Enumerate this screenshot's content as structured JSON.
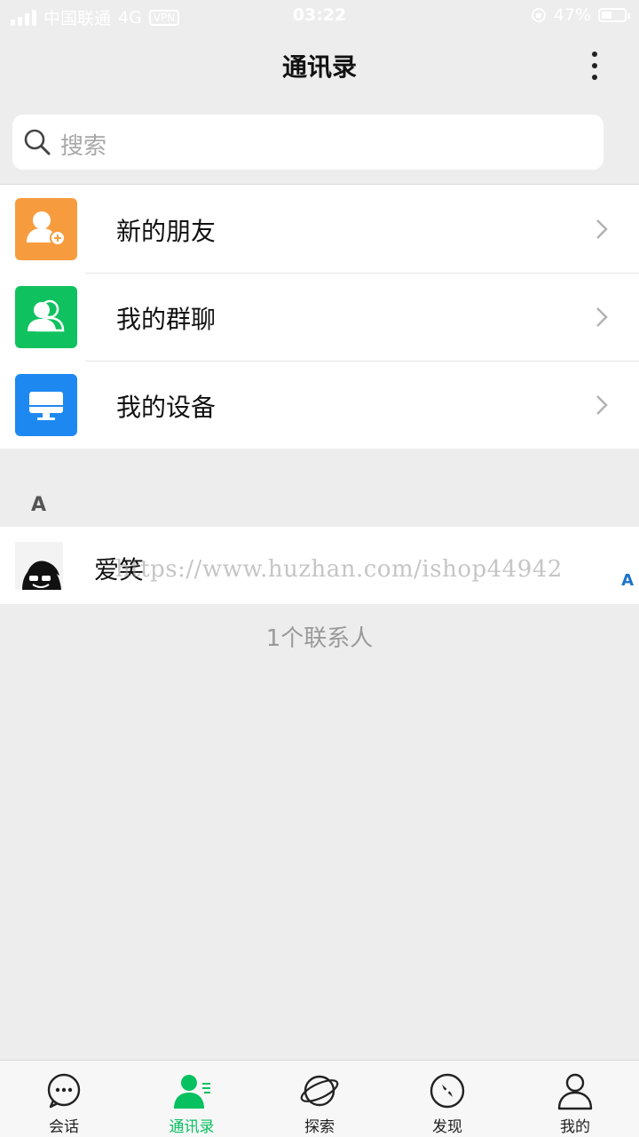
{
  "status_bar": {
    "carrier": "中国联通",
    "network": "4G",
    "vpn": "VPN",
    "time": "03:22",
    "battery_text": "47%",
    "battery_level": 0.47
  },
  "header": {
    "title": "通讯录"
  },
  "search": {
    "placeholder": "搜索"
  },
  "menu": {
    "items": [
      {
        "label": "新的朋友",
        "icon": "new-friend-icon",
        "color": "#f79c3e"
      },
      {
        "label": "我的群聊",
        "icon": "group-chat-icon",
        "color": "#10c25f"
      },
      {
        "label": "我的设备",
        "icon": "device-icon",
        "color": "#1e88f1"
      }
    ]
  },
  "contacts": {
    "section_letter": "A",
    "items": [
      {
        "name": "爱笑"
      }
    ],
    "index_letter": "A",
    "watermark": "https://www.huzhan.com/ishop44942",
    "count_text": "1个联系人"
  },
  "tabs": {
    "items": [
      {
        "label": "会话",
        "icon": "chat-icon"
      },
      {
        "label": "通讯录",
        "icon": "contacts-icon"
      },
      {
        "label": "探索",
        "icon": "planet-icon"
      },
      {
        "label": "发现",
        "icon": "compass-icon"
      },
      {
        "label": "我的",
        "icon": "profile-icon"
      }
    ],
    "active_index": 1,
    "active_color": "#07c160"
  }
}
